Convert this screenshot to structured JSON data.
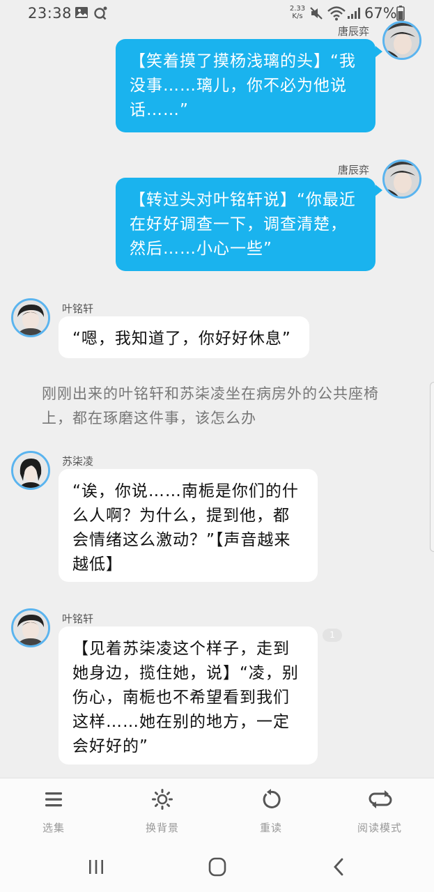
{
  "status_bar": {
    "time": "23:38",
    "speed_value": "2.33",
    "speed_unit": "K/s",
    "battery": "67%",
    "icons": [
      "gallery-icon",
      "search-icon",
      "mute-icon",
      "wifi-icon",
      "signal-icon",
      "battery-icon"
    ]
  },
  "messages": [
    {
      "speaker": "唐辰弈",
      "side": "right",
      "text": "【笑着摸了摸杨浅璃的头】“我没事……璃儿，你不必为他说话……”"
    },
    {
      "speaker": "唐辰弈",
      "side": "right",
      "text": "【转过头对叶铭轩说】“你最近在好好调查一下，调查清楚，然后……小心一些”"
    },
    {
      "speaker": "叶铭轩",
      "side": "left",
      "text": "“嗯，我知道了，你好好休息”"
    },
    {
      "speaker": "苏柒凌",
      "side": "left",
      "text": "“诶，你说……南栀是你们的什么人啊？为什么，提到他，都会情绪这么激动？”【声音越来越低】"
    },
    {
      "speaker": "叶铭轩",
      "side": "left",
      "text": "【见着苏柒凌这个样子，走到她身边，揽住她，说】“凌，别伤心，南栀也不希望看到我们这样……她在别的地方，一定会好好的”"
    }
  ],
  "narration": "刚刚出来的叶铭轩和苏柒凌坐在病房外的公共座椅上，都在琢磨这件事，该怎么办",
  "comment_count": "1",
  "toolbar": {
    "items": [
      {
        "label": "选集",
        "icon": "menu-icon"
      },
      {
        "label": "换背景",
        "icon": "brightness-icon"
      },
      {
        "label": "重读",
        "icon": "replay-icon"
      },
      {
        "label": "阅读模式",
        "icon": "repeat-mode-icon"
      }
    ]
  },
  "colors": {
    "accent": "#1ab3ee",
    "avatar_border": "#5ab4ef",
    "background": "#efefef"
  }
}
